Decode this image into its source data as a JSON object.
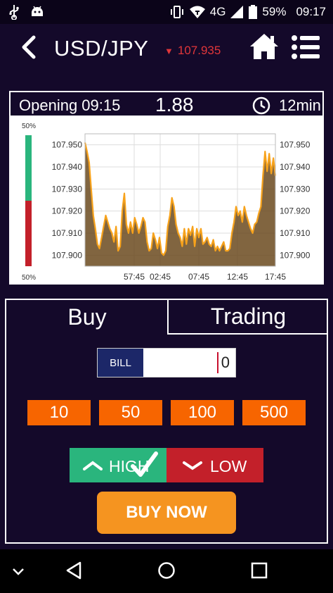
{
  "status": {
    "network": "4G",
    "battery": "59%",
    "time": "09:17"
  },
  "header": {
    "pair": "USD/JPY",
    "direction_arrow": "▼",
    "price": "107.935"
  },
  "timer": {
    "opening": "Opening 09:15",
    "payout": "1.88",
    "duration": "12min"
  },
  "chart_data": {
    "type": "area",
    "side_bar": {
      "top_label": "50%",
      "bottom_label": "50%",
      "up_fraction": 0.5
    },
    "y_ticks": [
      "107.950",
      "107.940",
      "107.930",
      "107.920",
      "107.910",
      "107.900"
    ],
    "y_values": [
      107.95,
      107.94,
      107.93,
      107.92,
      107.91,
      107.9
    ],
    "ylim": [
      107.895,
      107.955
    ],
    "x_ticks": [
      "57:45",
      "02:45",
      "07:45",
      "12:45",
      "17:45"
    ],
    "grid": true,
    "series": [
      {
        "values": [
          107.951,
          107.947,
          107.942,
          107.93,
          107.918,
          107.912,
          107.905,
          107.903,
          107.908,
          107.913,
          107.918,
          107.915,
          107.912,
          107.91,
          107.906,
          107.913,
          107.902,
          107.904,
          107.92,
          107.928,
          107.914,
          107.91,
          107.915,
          107.91,
          107.917,
          107.914,
          107.91,
          107.913,
          107.917,
          107.915,
          107.906,
          107.902,
          107.903,
          107.91,
          107.907,
          107.903,
          107.908,
          107.901,
          107.9,
          107.902,
          107.913,
          107.918,
          107.926,
          107.922,
          107.914,
          107.91,
          107.908,
          107.904,
          107.912,
          107.905,
          107.912,
          107.909,
          107.913,
          107.904,
          107.912,
          107.908,
          107.912,
          107.905,
          107.906,
          107.908,
          107.905,
          107.904,
          107.907,
          107.902,
          107.904,
          107.902,
          107.904,
          107.906,
          107.902,
          107.902,
          107.903,
          107.91,
          107.915,
          107.922,
          107.918,
          107.92,
          107.915,
          107.922,
          107.918,
          107.915,
          107.912,
          107.91,
          107.914,
          107.915,
          107.919,
          107.922,
          107.936,
          107.947,
          107.938,
          107.946,
          107.937,
          107.944,
          107.936
        ]
      }
    ],
    "colors": {
      "line": "#f7a21b",
      "fill": "#6b4a1e",
      "up": "#2ab57d",
      "down": "#c3202a"
    }
  },
  "tabs": {
    "buy": "Buy",
    "trading": "Trading"
  },
  "bill": {
    "label": "BILL",
    "value": "0"
  },
  "amounts": [
    "10",
    "50",
    "100",
    "500"
  ],
  "direction": {
    "high": "HIGH",
    "low": "LOW"
  },
  "buy_now": "BUY NOW"
}
